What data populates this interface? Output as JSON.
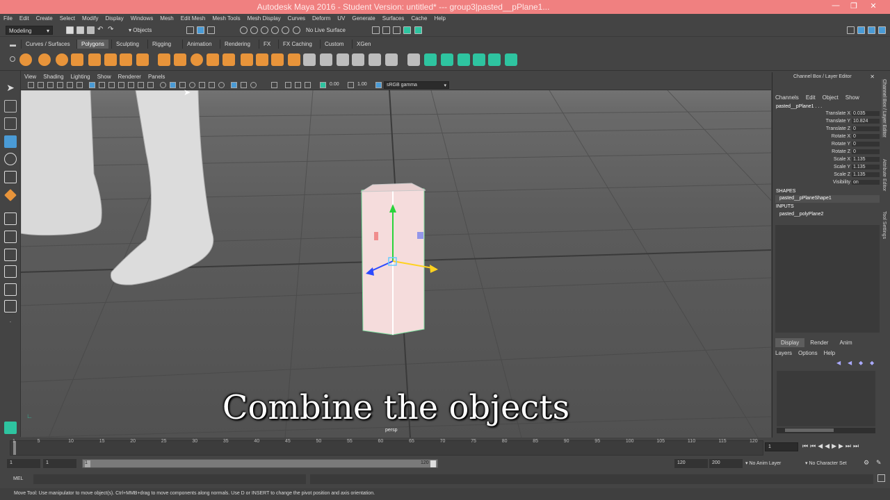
{
  "window": {
    "title": "Autodesk Maya 2016 - Student Version: untitled*    ---    group3|pasted__pPlane1..."
  },
  "menubar": [
    "File",
    "Edit",
    "Create",
    "Select",
    "Modify",
    "Display",
    "Windows",
    "Mesh",
    "Edit Mesh",
    "Mesh Tools",
    "Mesh Display",
    "Curves",
    "Deform",
    "UV",
    "Generate",
    "Surfaces",
    "Cache",
    "Help"
  ],
  "statusline": {
    "mode": "Modeling",
    "selection_mode": "Objects",
    "live_surface": "No Live Surface"
  },
  "shelf_tabs": [
    "Curves / Surfaces",
    "Polygons",
    "Sculpting",
    "Rigging",
    "Animation",
    "Rendering",
    "FX",
    "FX Caching",
    "Custom",
    "XGen"
  ],
  "shelf_active": "Polygons",
  "viewport": {
    "menu": [
      "View",
      "Shading",
      "Lighting",
      "Show",
      "Renderer",
      "Panels"
    ],
    "exposure": "0.00",
    "gamma": "1.00",
    "color_space": "sRGB gamma",
    "camera": "persp",
    "caption": "Combine the objects"
  },
  "channel_box": {
    "header": "Channel Box / Layer Editor",
    "menu": [
      "Channels",
      "Edit",
      "Object",
      "Show"
    ],
    "object": "pasted__pPlane1 . . .",
    "attributes": [
      {
        "label": "Translate X",
        "value": "0.035"
      },
      {
        "label": "Translate Y",
        "value": "10.824"
      },
      {
        "label": "Translate Z",
        "value": "0"
      },
      {
        "label": "Rotate X",
        "value": "0"
      },
      {
        "label": "Rotate Y",
        "value": "0"
      },
      {
        "label": "Rotate Z",
        "value": "0"
      },
      {
        "label": "Scale X",
        "value": "1.135"
      },
      {
        "label": "Scale Y",
        "value": "1.135"
      },
      {
        "label": "Scale Z",
        "value": "1.135"
      },
      {
        "label": "Visibility",
        "value": "on"
      }
    ],
    "shapes_label": "SHAPES",
    "shape": "pasted__pPlaneShape1",
    "inputs_label": "INPUTS",
    "input": "pasted__polyPlane2"
  },
  "layer_editor": {
    "tabs": [
      "Display",
      "Render",
      "Anim"
    ],
    "menu": [
      "Layers",
      "Options",
      "Help"
    ]
  },
  "side_tabs": [
    "Channel Box / Layer Editor",
    "Attribute Editor",
    "Tool Settings"
  ],
  "timeline": {
    "ticks": [
      "1",
      "5",
      "10",
      "15",
      "20",
      "25",
      "30",
      "35",
      "40",
      "45",
      "50",
      "55",
      "60",
      "65",
      "70",
      "75",
      "80",
      "85",
      "90",
      "95",
      "100",
      "105",
      "110",
      "115",
      "120"
    ],
    "current_frame": "1",
    "start": "1",
    "range_start": "1",
    "range_start_label": "1",
    "range_end_label": "120",
    "range_end": "120",
    "end": "200",
    "anim_layer": "No Anim Layer",
    "character_set": "No Character Set"
  },
  "command_line": {
    "label": "MEL"
  },
  "help_line": {
    "text": "Move Tool: Use manipulator to move object(s). Ctrl+MMB+drag to move components along normals. Use D or INSERT to change the pivot position and axis orientation."
  },
  "colors": {
    "titlebar": "#f08080",
    "active_tab": "#5d5d5d",
    "shelf_icon": "#e8943a",
    "poly_icon": "#2ec4a0"
  }
}
